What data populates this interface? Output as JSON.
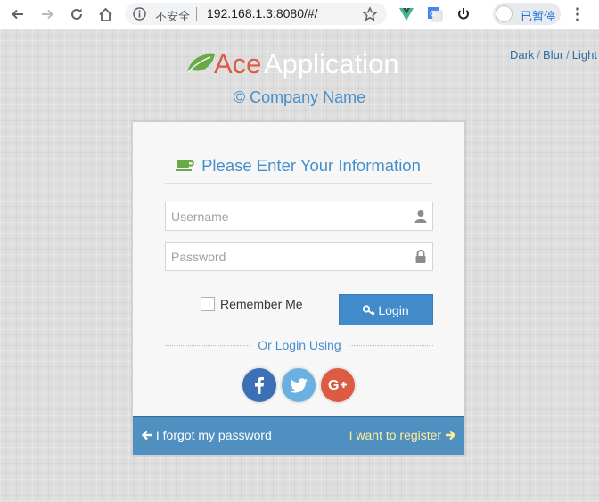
{
  "browser": {
    "security_label": "不安全",
    "url": "192.168.1.3:8080/#/",
    "profile_status": "已暂停"
  },
  "theme_switcher": {
    "items": [
      "Dark",
      "Blur",
      "Light"
    ],
    "separator": "/"
  },
  "brand": {
    "name_part1": "Ace",
    "name_part2": "Application",
    "company": "© Company Name",
    "accent_color": "#dd5a43",
    "primary_color": "#478fca"
  },
  "login": {
    "header": "Please Enter Your Information",
    "username_placeholder": "Username",
    "password_placeholder": "Password",
    "remember_label": "Remember Me",
    "login_button": "Login",
    "or_text": "Or Login Using",
    "forgot_link": "I forgot my password",
    "register_link": "I want to register"
  },
  "icons": {
    "username": "user-icon",
    "password": "lock-icon",
    "header": "coffee-icon",
    "login_button": "key-icon",
    "social": [
      "facebook-icon",
      "twitter-icon",
      "google-plus-icon"
    ]
  }
}
